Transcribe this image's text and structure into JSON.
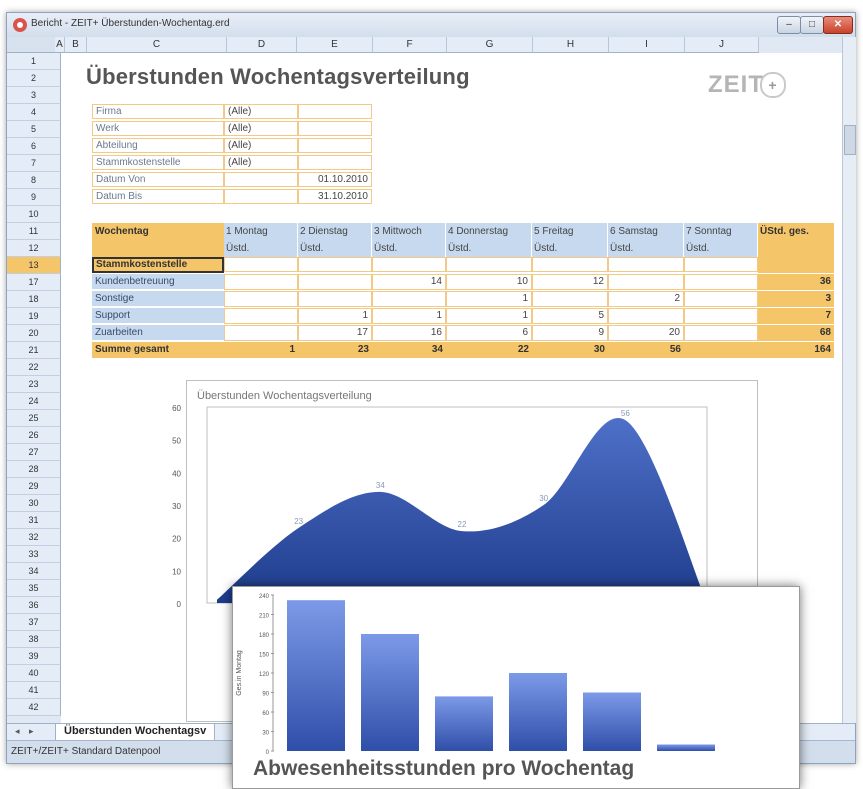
{
  "window": {
    "title": "Bericht - ZEIT+ Überstunden-Wochentag.erd",
    "minimize": "–",
    "maximize": "□",
    "close": "✕"
  },
  "columns": [
    "A",
    "B",
    "C",
    "D",
    "E",
    "F",
    "G",
    "H",
    "I",
    "J"
  ],
  "rows": [
    "1",
    "2",
    "3",
    "4",
    "5",
    "6",
    "7",
    "8",
    "9",
    "10",
    "11",
    "12",
    "13",
    "17",
    "18",
    "19",
    "20",
    "21",
    "22",
    "23",
    "24",
    "25",
    "26",
    "27",
    "28",
    "29",
    "30",
    "31",
    "32",
    "33",
    "34",
    "35",
    "36",
    "37",
    "38",
    "39",
    "40",
    "41",
    "42"
  ],
  "selected_row": "13",
  "sheet": {
    "title": "Überstunden Wochentagsverteilung",
    "logo": "ZEIT",
    "logo_plus": "+"
  },
  "filters": [
    {
      "label": "Firma",
      "value": "(Alle)"
    },
    {
      "label": "Werk",
      "value": "(Alle)"
    },
    {
      "label": "Abteilung",
      "value": "(Alle)"
    },
    {
      "label": "Stammkostenstelle",
      "value": "(Alle)"
    },
    {
      "label": "Datum Von",
      "value": "01.10.2010"
    },
    {
      "label": "Datum Bis",
      "value": "31.10.2010"
    }
  ],
  "table": {
    "corner_label": "Wochentag",
    "days": [
      "1 Montag",
      "2 Dienstag",
      "3 Mittwoch",
      "4 Donnerstag",
      "5 Freitag",
      "6 Samstag",
      "7 Sonntag"
    ],
    "unit": "Üstd.",
    "total_header": "ÜStd. ges.",
    "group_label": "Stammkostenstelle",
    "rows": [
      {
        "label": "Kundenbetreuung",
        "values": [
          "",
          "",
          "14",
          "10",
          "12",
          "",
          ""
        ],
        "total": "36"
      },
      {
        "label": "Sonstige",
        "values": [
          "",
          "",
          "",
          "1",
          "",
          "2",
          ""
        ],
        "total": "3"
      },
      {
        "label": "Support",
        "values": [
          "",
          "1",
          "1",
          "1",
          "5",
          "",
          ""
        ],
        "total": "7"
      },
      {
        "label": "Zuarbeiten",
        "values": [
          "",
          "17",
          "16",
          "6",
          "9",
          "20",
          ""
        ],
        "total": "68"
      }
    ],
    "sum_label": "Summe gesamt",
    "sum_values": [
      "1",
      "23",
      "34",
      "22",
      "30",
      "56",
      ""
    ],
    "sum_total": "164"
  },
  "chart_data": [
    {
      "type": "area",
      "title": "Überstunden Wochentagsverteilung",
      "categories": [
        "1 Montag",
        "2 Dienstag",
        "3 Mittwoch",
        "4 Donnerstag",
        "5 Freitag",
        "6 Samstag",
        "7 Sonntag"
      ],
      "values": [
        1,
        23,
        34,
        22,
        30,
        56,
        0
      ],
      "data_labels": [
        "23",
        "34",
        "22",
        "30",
        "56"
      ],
      "yticks": [
        "0",
        "10",
        "20",
        "30",
        "40",
        "50",
        "60"
      ],
      "ylim": [
        0,
        60
      ],
      "color": "#2f4f9e"
    },
    {
      "type": "bar",
      "title": "Abwesenheitsstunden pro Wochentag",
      "ylabel": "Ges.in Montag",
      "values": [
        232,
        180,
        84,
        120,
        90,
        10
      ],
      "yticks": [
        "0",
        "30",
        "60",
        "90",
        "120",
        "150",
        "180",
        "210",
        "240"
      ],
      "ylim": [
        0,
        240
      ],
      "color": "#4a68c0"
    }
  ],
  "tabs": {
    "active": "Überstunden Wochentagsv",
    "prev": "◂",
    "next": "▸"
  },
  "status": "ZEIT+/ZEIT+ Standard Datenpool"
}
